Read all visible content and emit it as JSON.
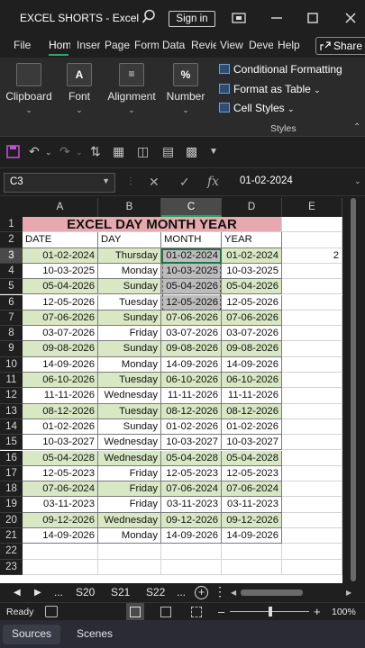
{
  "window": {
    "title": "EXCEL SHORTS - Excel",
    "signin_label": "Sign in"
  },
  "ribbon_tabs": [
    {
      "label": "File"
    },
    {
      "label": "Home"
    },
    {
      "label": "Insert"
    },
    {
      "label": "Page"
    },
    {
      "label": "Formulas"
    },
    {
      "label": "Data"
    },
    {
      "label": "Review"
    },
    {
      "label": "View"
    },
    {
      "label": "Developer"
    },
    {
      "label": "Help"
    }
  ],
  "share_label": "Share",
  "ribbon": {
    "clipboard": "Clipboard",
    "font": "Font",
    "alignment": "Alignment",
    "number": "Number",
    "conditional_formatting": "Conditional Formatting",
    "format_as_table": "Format as Table",
    "cell_styles": "Cell Styles",
    "styles_group": "Styles"
  },
  "formula_bar": {
    "name_box": "C3",
    "value": "01-02-2024"
  },
  "columns": [
    "A",
    "B",
    "C",
    "D",
    "E"
  ],
  "selected_cell": "C3",
  "sheet": {
    "title": "EXCEL DAY MONTH YEAR",
    "headers": [
      "DATE",
      "DAY",
      "MONTH",
      "YEAR"
    ],
    "e3_value": "2",
    "c3_visible": "01-02-2024",
    "rows": [
      {
        "date": "01-02-2024",
        "day": "Thursday",
        "month": "01-02-2024",
        "year": "01-02-2024",
        "green": true
      },
      {
        "date": "10-03-2025",
        "day": "Monday",
        "month": "10-03-2025",
        "year": "10-03-2025",
        "green": false
      },
      {
        "date": "05-04-2026",
        "day": "Sunday",
        "month": "05-04-2026",
        "year": "05-04-2026",
        "green": true
      },
      {
        "date": "12-05-2026",
        "day": "Tuesday",
        "month": "12-05-2026",
        "year": "12-05-2026",
        "green": false
      },
      {
        "date": "07-06-2026",
        "day": "Sunday",
        "month": "07-06-2026",
        "year": "07-06-2026",
        "green": true
      },
      {
        "date": "03-07-2026",
        "day": "Friday",
        "month": "03-07-2026",
        "year": "03-07-2026",
        "green": false
      },
      {
        "date": "09-08-2026",
        "day": "Sunday",
        "month": "09-08-2026",
        "year": "09-08-2026",
        "green": true
      },
      {
        "date": "14-09-2026",
        "day": "Monday",
        "month": "14-09-2026",
        "year": "14-09-2026",
        "green": false
      },
      {
        "date": "06-10-2026",
        "day": "Tuesday",
        "month": "06-10-2026",
        "year": "06-10-2026",
        "green": true
      },
      {
        "date": "11-11-2026",
        "day": "Wednesday",
        "month": "11-11-2026",
        "year": "11-11-2026",
        "green": false
      },
      {
        "date": "08-12-2026",
        "day": "Tuesday",
        "month": "08-12-2026",
        "year": "08-12-2026",
        "green": true
      },
      {
        "date": "01-02-2026",
        "day": "Sunday",
        "month": "01-02-2026",
        "year": "01-02-2026",
        "green": false
      },
      {
        "date": "10-03-2027",
        "day": "Wednesday",
        "month": "10-03-2027",
        "year": "10-03-2027",
        "green": false
      },
      {
        "date": "05-04-2028",
        "day": "Wednesday",
        "month": "05-04-2028",
        "year": "05-04-2028",
        "green": true
      },
      {
        "date": "12-05-2023",
        "day": "Friday",
        "month": "12-05-2023",
        "year": "12-05-2023",
        "green": false
      },
      {
        "date": "07-06-2024",
        "day": "Friday",
        "month": "07-06-2024",
        "year": "07-06-2024",
        "green": true
      },
      {
        "date": "03-11-2023",
        "day": "Friday",
        "month": "03-11-2023",
        "year": "03-11-2023",
        "green": false
      },
      {
        "date": "09-12-2026",
        "day": "Wednesday",
        "month": "09-12-2026",
        "year": "09-12-2026",
        "green": true
      },
      {
        "date": "14-09-2026",
        "day": "Monday",
        "month": "14-09-2026",
        "year": "14-09-2026",
        "green": false
      }
    ]
  },
  "sheet_tabs": [
    {
      "label": "S20"
    },
    {
      "label": "S21"
    },
    {
      "label": "S22"
    }
  ],
  "sheet_nav_more": "...",
  "status": {
    "ready": "Ready",
    "zoom": "100%"
  },
  "bottom_strip": {
    "sources": "Sources",
    "scenes": "Scenes"
  },
  "colors": {
    "green_row": "#d9e8c4",
    "title_fill": "#e8a9ae",
    "accent": "#21a366"
  }
}
